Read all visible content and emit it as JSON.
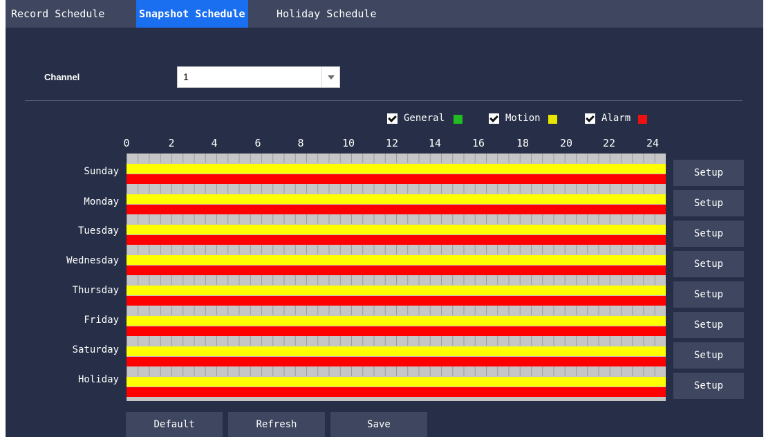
{
  "tabs": [
    {
      "label": "Record Schedule",
      "active": false
    },
    {
      "label": "Snapshot Schedule",
      "active": true
    },
    {
      "label": "Holiday Schedule",
      "active": false
    }
  ],
  "channel": {
    "label": "Channel",
    "value": "1"
  },
  "legend": [
    {
      "label": "General",
      "checked": true,
      "color": "#22bb22"
    },
    {
      "label": "Motion",
      "checked": true,
      "color": "#e6e600"
    },
    {
      "label": "Alarm",
      "checked": true,
      "color": "#ee1111"
    }
  ],
  "hour_ticks": [
    "0",
    "2",
    "4",
    "6",
    "8",
    "10",
    "12",
    "14",
    "16",
    "18",
    "20",
    "22",
    "24"
  ],
  "days": [
    "Sunday",
    "Monday",
    "Tuesday",
    "Wednesday",
    "Thursday",
    "Friday",
    "Saturday",
    "Holiday"
  ],
  "setup_label": "Setup",
  "buttons": {
    "default": "Default",
    "refresh": "Refresh",
    "save": "Save"
  },
  "colors": {
    "general": "#c6c6c6",
    "motion": "#ffff00",
    "alarm": "#ff0000",
    "active_tab": "#1a6ef0"
  }
}
